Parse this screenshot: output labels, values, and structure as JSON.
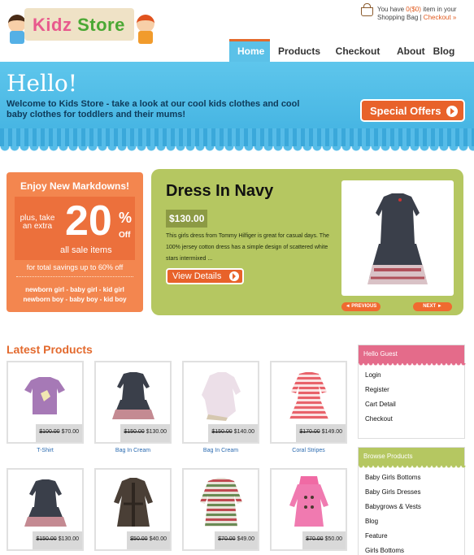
{
  "header": {
    "logo_text_a": "Kidz",
    "logo_text_b": "Store",
    "cart_line1_a": "You have ",
    "cart_count": "0($0)",
    "cart_line1_b": " item in your",
    "cart_line2": "Shopping Bag | ",
    "cart_checkout": "Checkout »"
  },
  "nav": [
    "Home",
    "Products",
    "Checkout",
    "About",
    "Blog"
  ],
  "hero": {
    "hello": "Hello!",
    "welcome": "Welcome to Kids Store - take a look at our cool kids clothes and cool baby clothes for toddlers and their mums!",
    "special_label": "Special Offers"
  },
  "markdown": {
    "title": "Enjoy New Markdowns!",
    "plus": "plus, take an extra",
    "number": "20",
    "pct": "%",
    "off": "Off",
    "sale": "all sale items",
    "total": "for total savings up to 60% off",
    "links1": "newborn girl  -  baby girl  -  kid girl",
    "links2": "newborn boy  -  baby boy  -  kid boy"
  },
  "feature": {
    "title": "Dress In Navy",
    "price": "$130.00",
    "desc": "This girls dress from Tommy Hilfiger is great for casual days. The 100% jersey cotton dress has a simple design of scattered white stars intermixed ...",
    "button": "View Details",
    "prev": "◄ PREVIOUS",
    "next": "NEXT ►"
  },
  "latest": {
    "title": "Latest Products",
    "products": [
      {
        "old": "$100.00",
        "new": "$70.00",
        "name": "T-Shirt"
      },
      {
        "old": "$150.00",
        "new": "$130.00",
        "name": "Bag In Cream"
      },
      {
        "old": "$150.00",
        "new": "$140.00",
        "name": "Bag In Cream"
      },
      {
        "old": "$170.00",
        "new": "$149.00",
        "name": "Coral  Stripes"
      },
      {
        "old": "$150.00",
        "new": "$130.00",
        "name": ""
      },
      {
        "old": "$50.00",
        "new": "$40.00",
        "name": ""
      },
      {
        "old": "$70.00",
        "new": "$49.00",
        "name": ""
      },
      {
        "old": "$70.00",
        "new": "$50.00",
        "name": ""
      }
    ]
  },
  "sidebar": {
    "guest_head": "Hello Guest",
    "guest_items": [
      "Login",
      "Register",
      "Cart Detail",
      "Checkout"
    ],
    "browse_head": "Browse Products",
    "browse_items": [
      "Baby Girls Bottoms",
      "Baby Girls Dresses",
      "Babygrows & Vests",
      "Blog",
      "Feature",
      "Girls Bottoms"
    ]
  },
  "colors": {
    "accent_orange": "#e8622a",
    "hero_blue": "#4fbae6",
    "feature_green": "#b5c761",
    "guest_pink": "#e46b8a"
  }
}
